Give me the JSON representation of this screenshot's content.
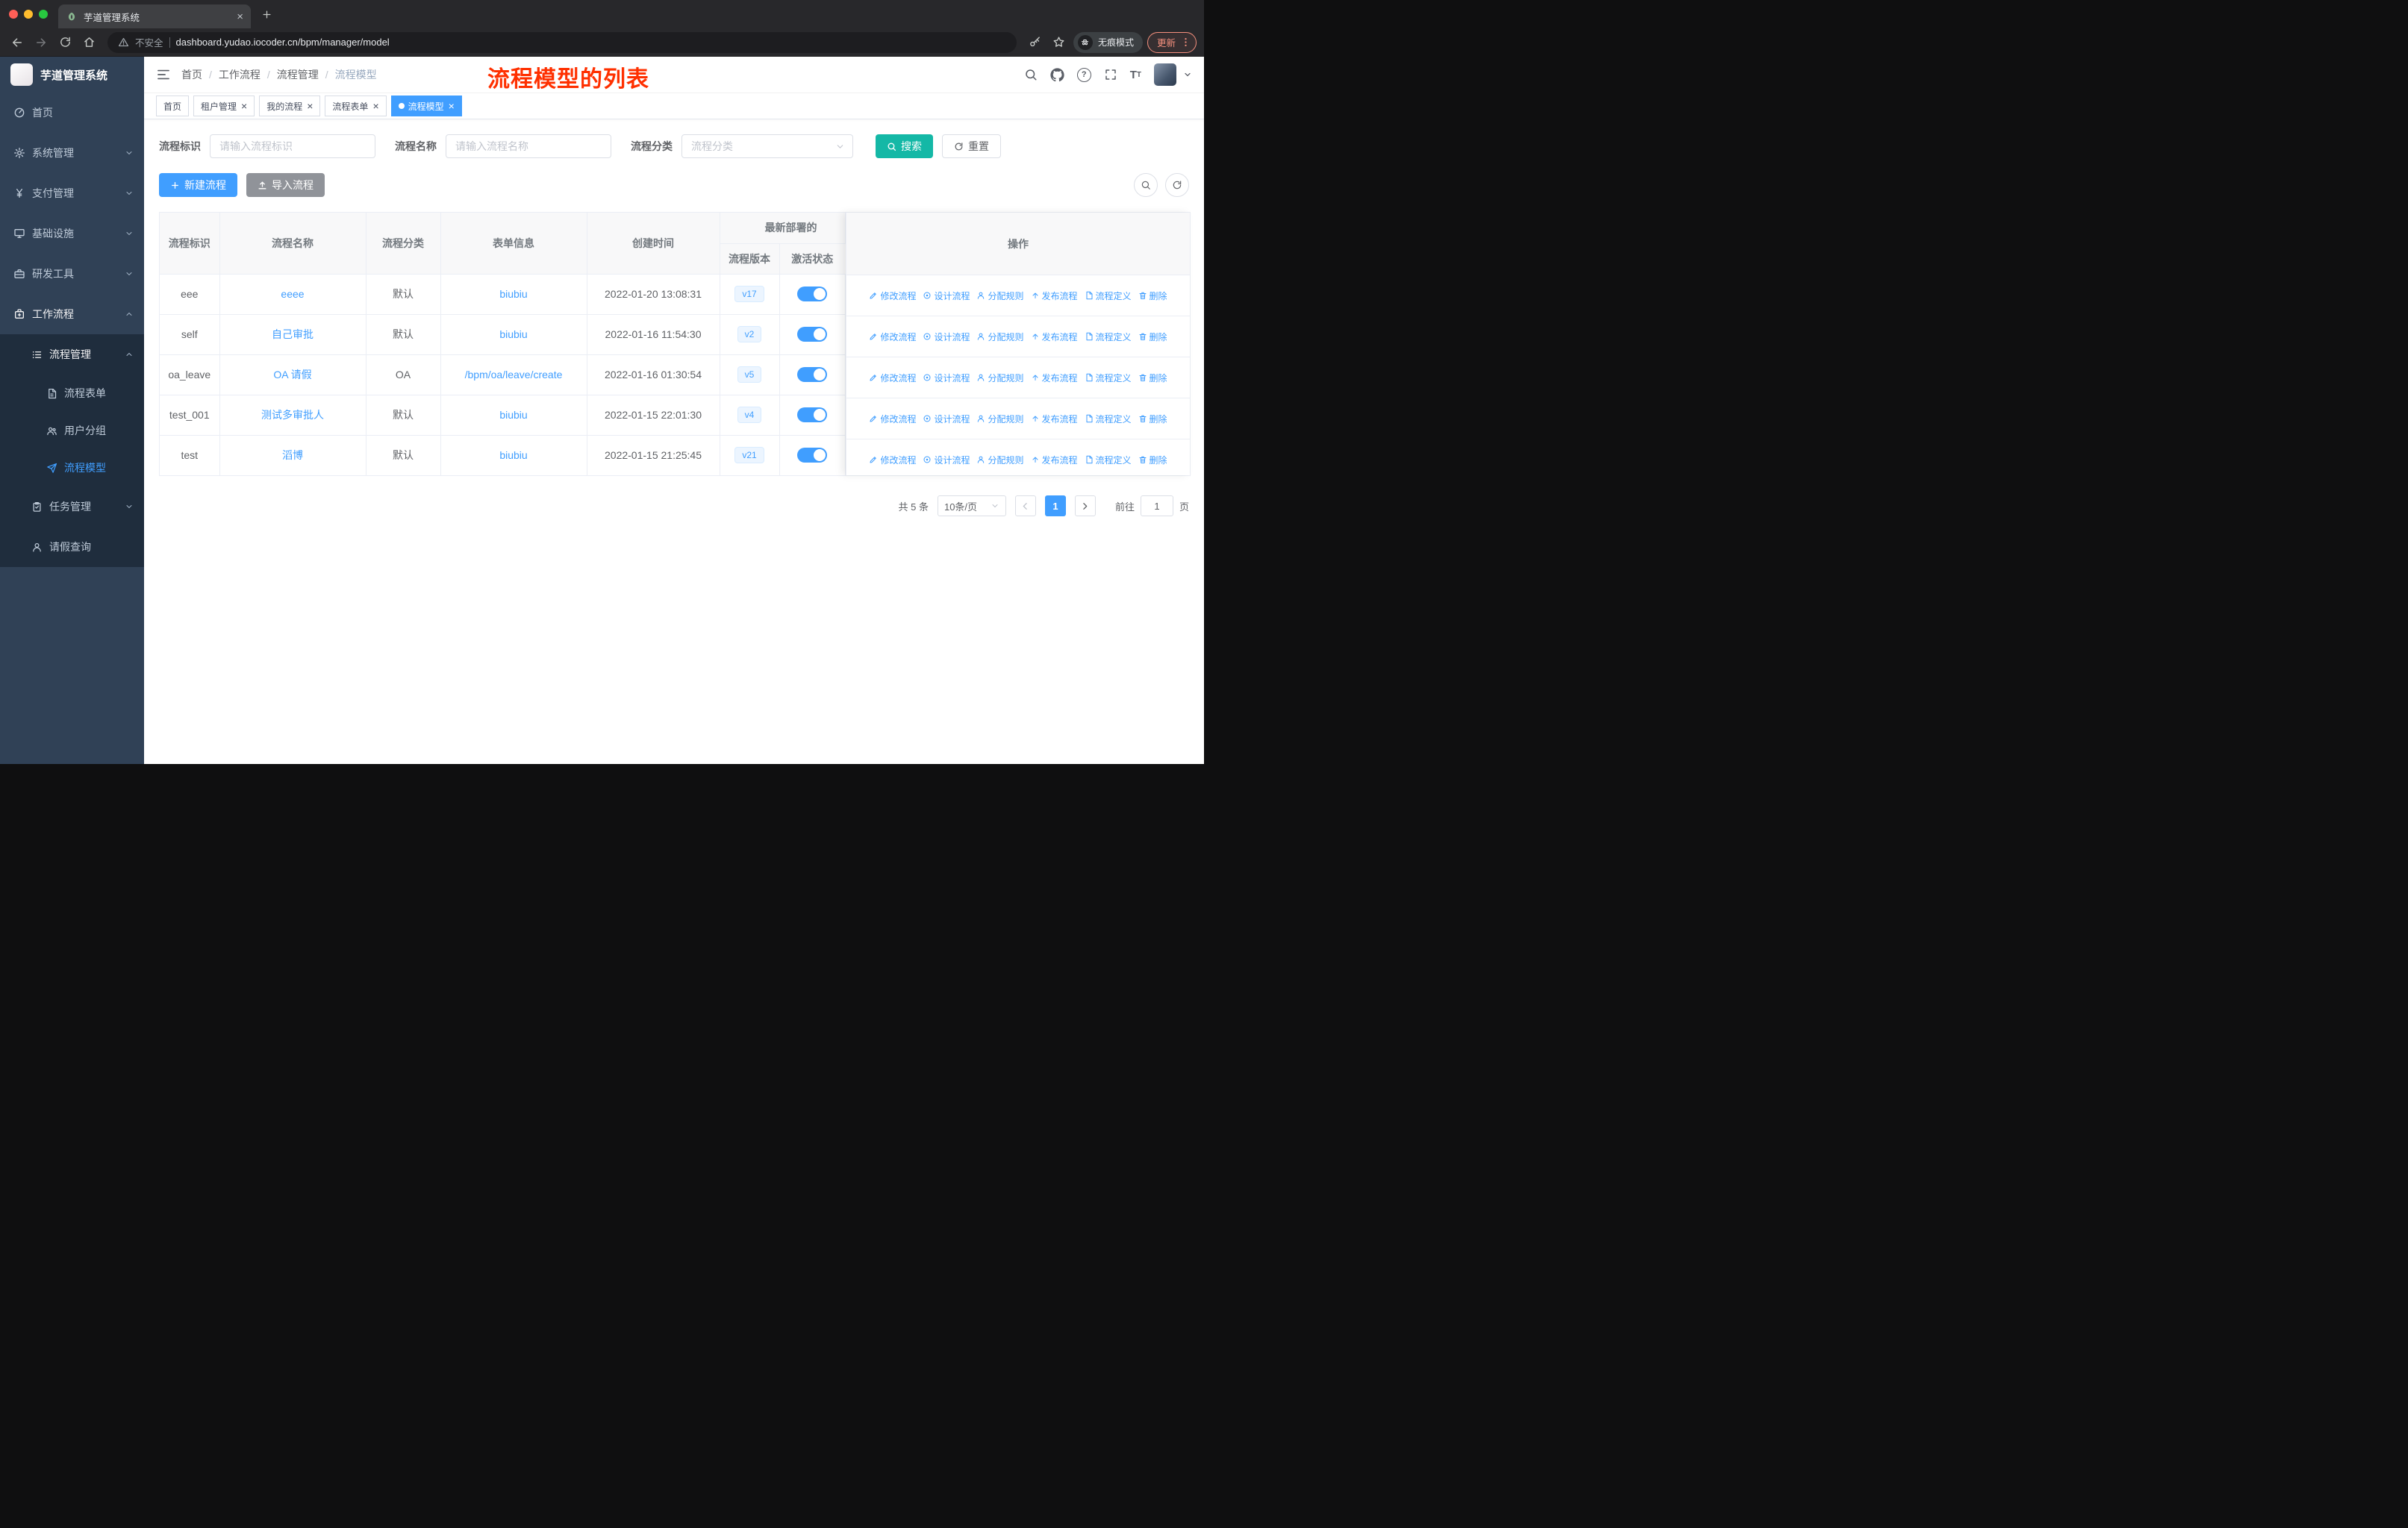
{
  "colors": {
    "accent": "#409eff",
    "search_button": "#14b8a6",
    "annotation": "#ff3000",
    "sidebar_bg": "#304156",
    "sidebar_submenu_bg": "#1f2d3d"
  },
  "browser": {
    "tab_title": "芋道管理系统",
    "security_label": "不安全",
    "url": "dashboard.yudao.iocoder.cn/bpm/manager/model",
    "incognito_label": "无痕模式",
    "update_label": "更新"
  },
  "sidebar": {
    "logo_title": "芋道管理系统",
    "items": [
      {
        "label": "首页",
        "icon": "dashboard-icon",
        "level": 1
      },
      {
        "label": "系统管理",
        "icon": "gear-icon",
        "level": 1,
        "chevron": "down"
      },
      {
        "label": "支付管理",
        "icon": "pay-icon",
        "level": 1,
        "chevron": "down"
      },
      {
        "label": "基础设施",
        "icon": "infra-icon",
        "level": 1,
        "chevron": "down"
      },
      {
        "label": "研发工具",
        "icon": "tools-icon",
        "level": 1,
        "chevron": "down"
      },
      {
        "label": "工作流程",
        "icon": "workflow-icon",
        "level": 1,
        "chevron": "up",
        "open": true
      },
      {
        "label": "流程管理",
        "icon": "process-manage-icon",
        "level": 2,
        "chevron": "up",
        "open": true
      },
      {
        "label": "流程表单",
        "icon": "form-icon",
        "level": 3
      },
      {
        "label": "用户分组",
        "icon": "user-group-icon",
        "level": 3
      },
      {
        "label": "流程模型",
        "icon": "paper-plane-icon",
        "level": 3,
        "active": true
      },
      {
        "label": "任务管理",
        "icon": "task-icon",
        "level": 2,
        "chevron": "down"
      },
      {
        "label": "请假查询",
        "icon": "user-icon",
        "level": 2
      }
    ]
  },
  "header": {
    "breadcrumb": [
      "首页",
      "工作流程",
      "流程管理",
      "流程模型"
    ],
    "annotation": "流程模型的列表"
  },
  "tags": [
    {
      "label": "首页",
      "closable": false,
      "active": false
    },
    {
      "label": "租户管理",
      "closable": true,
      "active": false
    },
    {
      "label": "我的流程",
      "closable": true,
      "active": false
    },
    {
      "label": "流程表单",
      "closable": true,
      "active": false
    },
    {
      "label": "流程模型",
      "closable": true,
      "active": true
    }
  ],
  "filters": {
    "field1_label": "流程标识",
    "field1_placeholder": "请输入流程标识",
    "field2_label": "流程名称",
    "field2_placeholder": "请输入流程名称",
    "field3_label": "流程分类",
    "field3_placeholder": "流程分类",
    "search_label": "搜索",
    "reset_label": "重置"
  },
  "toolbar": {
    "create_label": "新建流程",
    "import_label": "导入流程"
  },
  "table": {
    "headers": {
      "id": "流程标识",
      "name": "流程名称",
      "category": "流程分类",
      "form": "表单信息",
      "created": "创建时间",
      "deploy_group": "最新部署的",
      "version": "流程版本",
      "active": "激活状态",
      "actions": "操作"
    },
    "rows": [
      {
        "id": "eee",
        "name": "eeee",
        "category": "默认",
        "form": "biubiu",
        "created": "2022-01-20 13:08:31",
        "version": "v17",
        "active": true
      },
      {
        "id": "self",
        "name": "自己审批",
        "category": "默认",
        "form": "biubiu",
        "created": "2022-01-16 11:54:30",
        "version": "v2",
        "active": true
      },
      {
        "id": "oa_leave",
        "name": "OA 请假",
        "category": "OA",
        "form": "/bpm/oa/leave/create",
        "created": "2022-01-16 01:30:54",
        "version": "v5",
        "active": true
      },
      {
        "id": "test_001",
        "name": "测试多审批人",
        "category": "默认",
        "form": "biubiu",
        "created": "2022-01-15 22:01:30",
        "version": "v4",
        "active": true
      },
      {
        "id": "test",
        "name": "滔博",
        "category": "默认",
        "form": "biubiu",
        "created": "2022-01-15 21:25:45",
        "version": "v21",
        "active": true
      }
    ],
    "actions": [
      {
        "label": "修改流程",
        "icon": "edit-icon"
      },
      {
        "label": "设计流程",
        "icon": "design-icon"
      },
      {
        "label": "分配规则",
        "icon": "assign-icon"
      },
      {
        "label": "发布流程",
        "icon": "publish-icon"
      },
      {
        "label": "流程定义",
        "icon": "definition-icon"
      },
      {
        "label": "删除",
        "icon": "delete-icon"
      }
    ]
  },
  "pagination": {
    "total": "共 5 条",
    "page_size": "10条/页",
    "current_page": "1",
    "goto_label": "前往",
    "goto_value": "1",
    "page_unit": "页"
  }
}
